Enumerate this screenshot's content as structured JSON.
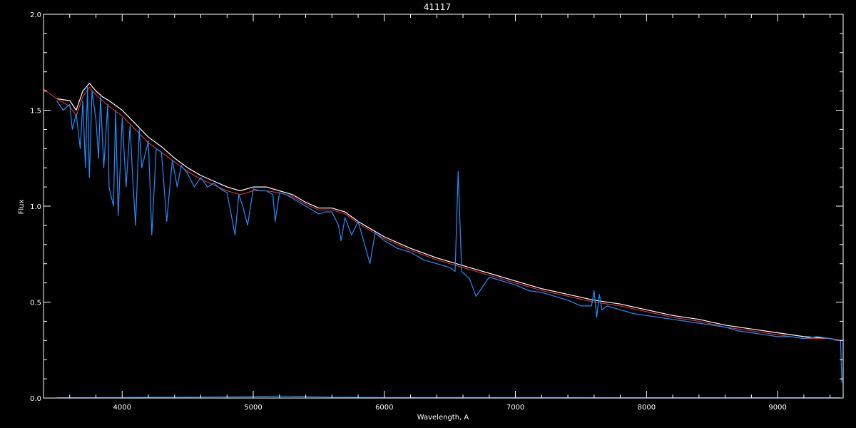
{
  "chart_data": {
    "type": "line",
    "title": "41117",
    "xlabel": "Wavelength, A",
    "ylabel": "Flux",
    "xlim": [
      3400,
      9500
    ],
    "ylim": [
      0,
      2
    ],
    "x_ticks": [
      4000,
      5000,
      6000,
      7000,
      8000,
      9000
    ],
    "y_ticks": [
      0.0,
      0.5,
      1.0,
      1.5,
      2.0
    ],
    "y_tick_labels": [
      "0.0",
      "0.5",
      "1.0",
      "1.5",
      "2.0"
    ],
    "grid": false,
    "colors": {
      "background": "#000000",
      "axes": "#ffffff",
      "observed": "#ffffff",
      "model": "#ff3030",
      "spectrum": "#1e8fff"
    },
    "series": [
      {
        "key": "observed",
        "x": [
          3500,
          3600,
          3650,
          3700,
          3750,
          3800,
          3850,
          3900,
          4000,
          4100,
          4200,
          4300,
          4400,
          4500,
          4600,
          4700,
          4800,
          4900,
          5000,
          5100,
          5200,
          5300,
          5400,
          5500,
          5600,
          5700,
          5800,
          5900,
          6000,
          6200,
          6400,
          6600,
          6800,
          7000,
          7200,
          7400,
          7600,
          7800,
          8000,
          8200,
          8400,
          8600,
          8800,
          9000,
          9200,
          9400,
          9480
        ],
        "y": [
          1.56,
          1.55,
          1.5,
          1.6,
          1.64,
          1.6,
          1.57,
          1.55,
          1.5,
          1.43,
          1.36,
          1.31,
          1.25,
          1.2,
          1.16,
          1.13,
          1.1,
          1.08,
          1.1,
          1.1,
          1.08,
          1.06,
          1.02,
          0.99,
          0.99,
          0.97,
          0.92,
          0.88,
          0.84,
          0.78,
          0.73,
          0.69,
          0.65,
          0.61,
          0.57,
          0.54,
          0.51,
          0.49,
          0.46,
          0.43,
          0.41,
          0.38,
          0.36,
          0.34,
          0.32,
          0.31,
          0.3
        ]
      },
      {
        "key": "model",
        "x": [
          3400,
          3500,
          3600,
          3650,
          3700,
          3750,
          3800,
          3850,
          3900,
          4000,
          4100,
          4200,
          4300,
          4400,
          4500,
          4600,
          4700,
          4800,
          4900,
          5000,
          5100,
          5200,
          5300,
          5400,
          5500,
          5600,
          5700,
          5800,
          5900,
          6000,
          6200,
          6400,
          6600,
          6800,
          7000,
          7200,
          7400,
          7600,
          7800,
          8000,
          8200,
          8400,
          8600,
          8800,
          9000,
          9200,
          9400,
          9500
        ],
        "y": [
          1.61,
          1.56,
          1.52,
          1.47,
          1.57,
          1.62,
          1.58,
          1.55,
          1.52,
          1.47,
          1.4,
          1.33,
          1.28,
          1.23,
          1.18,
          1.14,
          1.11,
          1.08,
          1.06,
          1.08,
          1.08,
          1.07,
          1.05,
          1.01,
          0.98,
          0.98,
          0.96,
          0.91,
          0.87,
          0.83,
          0.77,
          0.72,
          0.68,
          0.64,
          0.6,
          0.56,
          0.53,
          0.5,
          0.48,
          0.45,
          0.42,
          0.4,
          0.37,
          0.35,
          0.33,
          0.31,
          0.31,
          0.3
        ]
      },
      {
        "key": "spectrum",
        "x": [
          3500,
          3550,
          3600,
          3620,
          3650,
          3680,
          3700,
          3720,
          3735,
          3750,
          3770,
          3800,
          3820,
          3835,
          3860,
          3890,
          3900,
          3934,
          3950,
          3970,
          4000,
          4030,
          4060,
          4080,
          4102,
          4130,
          4150,
          4200,
          4226,
          4260,
          4300,
          4340,
          4383,
          4420,
          4450,
          4500,
          4550,
          4600,
          4650,
          4700,
          4750,
          4800,
          4861,
          4890,
          4920,
          4957,
          5000,
          5050,
          5100,
          5150,
          5167,
          5200,
          5250,
          5300,
          5350,
          5400,
          5450,
          5500,
          5550,
          5600,
          5650,
          5670,
          5700,
          5750,
          5800,
          5850,
          5890,
          5930,
          6000,
          6100,
          6200,
          6300,
          6400,
          6500,
          6540,
          6563,
          6590,
          6650,
          6700,
          6800,
          6900,
          7000,
          7100,
          7200,
          7300,
          7400,
          7500,
          7580,
          7600,
          7620,
          7640,
          7660,
          7700,
          7800,
          7900,
          8000,
          8100,
          8200,
          8300,
          8400,
          8500,
          8600,
          8700,
          8800,
          8900,
          9000,
          9100,
          9200,
          9300,
          9400,
          9450,
          9480,
          9490
        ],
        "y": [
          1.55,
          1.5,
          1.53,
          1.4,
          1.48,
          1.3,
          1.55,
          1.2,
          1.62,
          1.15,
          1.6,
          1.45,
          1.25,
          1.57,
          1.2,
          1.53,
          1.1,
          1.0,
          1.5,
          0.95,
          1.46,
          1.1,
          1.42,
          1.15,
          0.9,
          1.4,
          1.2,
          1.34,
          0.85,
          1.3,
          1.28,
          0.92,
          1.24,
          1.1,
          1.21,
          1.17,
          1.1,
          1.15,
          1.1,
          1.12,
          1.09,
          1.07,
          0.85,
          1.06,
          1.0,
          0.9,
          1.09,
          1.08,
          1.08,
          1.06,
          0.92,
          1.07,
          1.06,
          1.04,
          1.02,
          1.0,
          0.98,
          0.96,
          0.97,
          0.97,
          0.9,
          0.82,
          0.94,
          0.85,
          0.92,
          0.8,
          0.7,
          0.86,
          0.82,
          0.78,
          0.76,
          0.72,
          0.7,
          0.68,
          0.66,
          1.18,
          0.66,
          0.62,
          0.53,
          0.63,
          0.61,
          0.59,
          0.56,
          0.55,
          0.53,
          0.51,
          0.48,
          0.48,
          0.56,
          0.42,
          0.54,
          0.46,
          0.48,
          0.46,
          0.44,
          0.43,
          0.42,
          0.41,
          0.4,
          0.39,
          0.38,
          0.37,
          0.35,
          0.34,
          0.33,
          0.32,
          0.32,
          0.31,
          0.32,
          0.31,
          0.3,
          0.3,
          0.08
        ]
      },
      {
        "key": "baseline",
        "x": [
          3500,
          4000,
          4500,
          5000,
          5200,
          5400,
          5600,
          6000,
          7000,
          8000,
          9000,
          9480
        ],
        "y": [
          0.002,
          0.003,
          0.005,
          0.008,
          0.01,
          0.009,
          0.004,
          0.003,
          0.003,
          0.002,
          0.002,
          0.002
        ]
      }
    ]
  }
}
